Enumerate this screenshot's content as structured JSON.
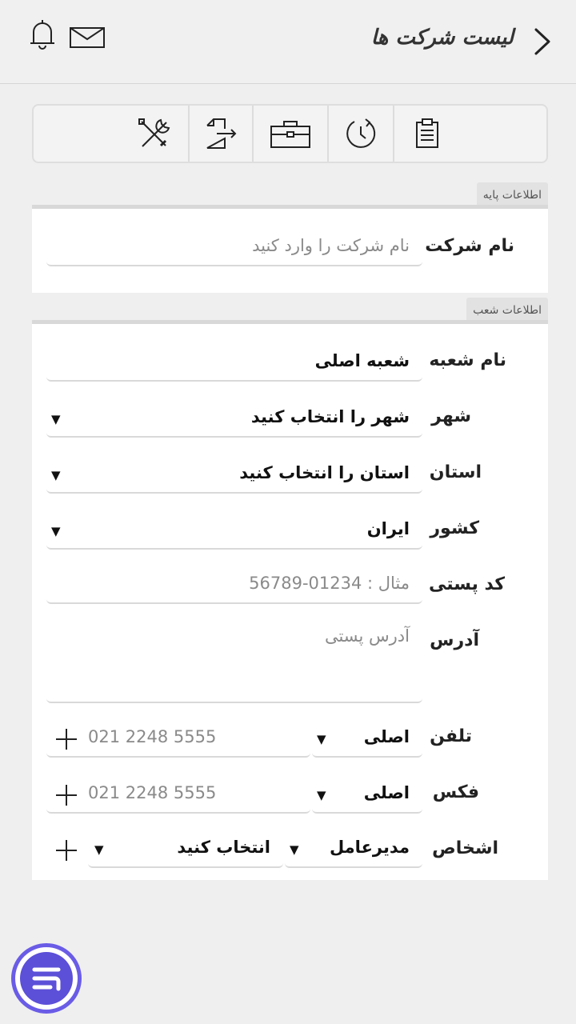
{
  "header": {
    "title": "لیست شرکت ها",
    "back_icon": "chevron-right-icon",
    "notifications_icon": "bell-icon",
    "messages_icon": "mail-icon"
  },
  "toolbar": {
    "items": [
      {
        "icon": "clipboard-icon"
      },
      {
        "icon": "history-icon"
      },
      {
        "icon": "briefcase-icon"
      },
      {
        "icon": "export-icon"
      },
      {
        "icon": "tools-icon"
      }
    ]
  },
  "basic_info": {
    "tag": "اطلاعات پایه",
    "company_name": {
      "label": "نام شرکت",
      "placeholder": "نام شرکت را وارد کنید"
    }
  },
  "branch_info": {
    "tag": "اطلاعات شعب",
    "branch_name": {
      "label": "نام شعبه",
      "value": "شعبه اصلی"
    },
    "city": {
      "label": "شهر",
      "value": "شهر را انتخاب کنید"
    },
    "province": {
      "label": "استان",
      "value": "استان را انتخاب کنید"
    },
    "country": {
      "label": "کشور",
      "value": "ایران"
    },
    "postal_code": {
      "label": "کد پستی",
      "placeholder": "مثال : 01234-56789"
    },
    "address": {
      "label": "آدرس",
      "placeholder": "آدرس پستی"
    },
    "phone": {
      "label": "تلفن",
      "type": "اصلی",
      "placeholder": "021 2248 5555"
    },
    "fax": {
      "label": "فکس",
      "type": "اصلی",
      "placeholder": "021 2248 5555"
    },
    "persons": {
      "label": "اشخاص",
      "role": "مدیرعامل",
      "person": "انتخاب کنید"
    }
  },
  "colors": {
    "accent": "#5c4fd8",
    "background": "#efefef"
  },
  "fab": {
    "icon": "menu-icon"
  }
}
